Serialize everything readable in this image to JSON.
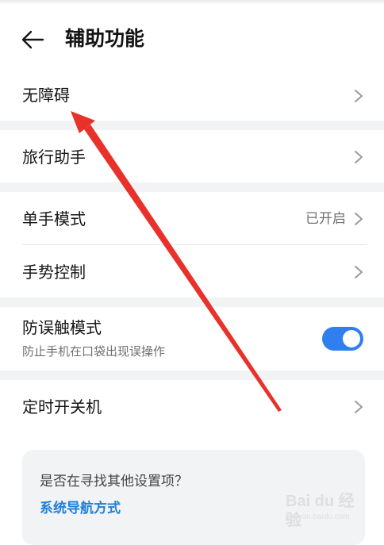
{
  "header": {
    "title": "辅助功能",
    "back_icon": "arrow-left-icon"
  },
  "rows": {
    "accessibility": {
      "label": "无障碍"
    },
    "travel_assistant": {
      "label": "旅行助手"
    },
    "one_hand_mode": {
      "label": "单手模式",
      "value": "已开启"
    },
    "gesture_control": {
      "label": "手势控制"
    },
    "accidental_touch": {
      "label": "防误触模式",
      "sublabel": "防止手机在口袋出现误操作",
      "toggle_on": true
    },
    "scheduled_power": {
      "label": "定时开关机"
    }
  },
  "suggestion_card": {
    "question": "是否在寻找其他设置项？",
    "link": "系统导航方式"
  },
  "watermark": {
    "brand": "Bai du 经验",
    "url": "jingyan.baidu.com"
  },
  "colors": {
    "accent": "#2f7ff0",
    "link": "#1f7fd9",
    "annotation_arrow": "#e8312a",
    "section_gap": "#f1f3f5"
  },
  "icons": {
    "chevron": "chevron-right-icon",
    "toggle": "toggle-switch"
  }
}
